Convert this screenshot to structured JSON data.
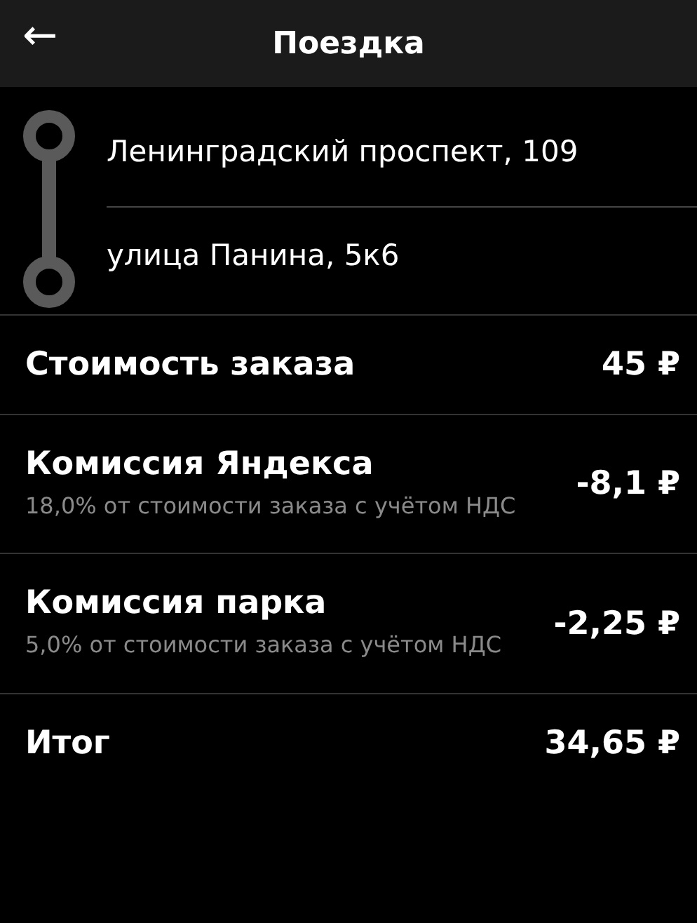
{
  "header": {
    "back": "←",
    "title": "Поездка"
  },
  "route": {
    "points": [
      "Ленинградский проспект, 109",
      "улица Панина, 5к6"
    ]
  },
  "rows": [
    {
      "title": "Стоимость заказа",
      "amount": "45 ₽"
    },
    {
      "title": "Комиссия Яндекса",
      "note": "18,0% от стоимости заказа с учётом НДС",
      "amount": "-8,1 ₽"
    },
    {
      "title": "Комиссия парка",
      "note": "5,0% от стоимости заказа с учётом НДС",
      "amount": "-2,25 ₽"
    },
    {
      "title": "Итог",
      "amount": "34,65 ₽"
    }
  ]
}
